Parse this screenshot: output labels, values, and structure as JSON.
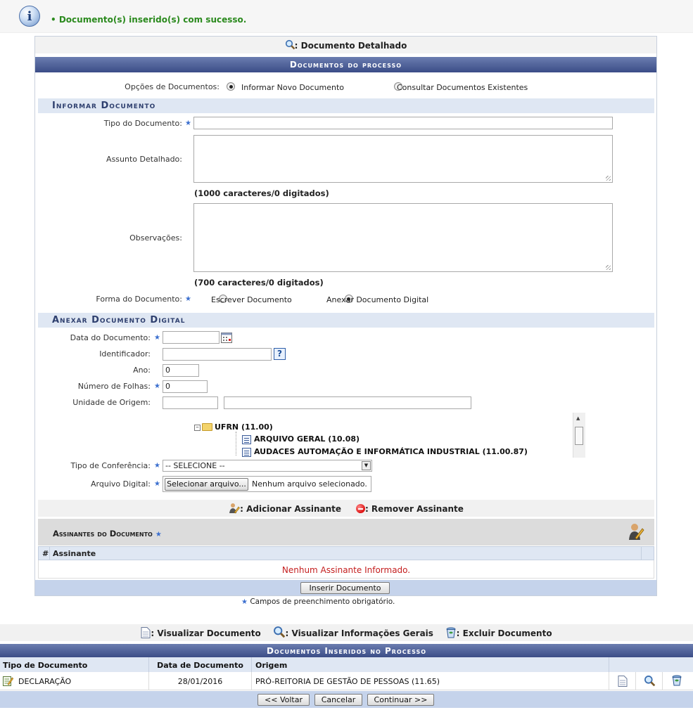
{
  "message": {
    "text": "• Documento(s) inserido(s) com sucesso."
  },
  "form": {
    "top_link": ": Documento Detalhado",
    "section_title": "Documentos do processo",
    "options_label": "Opções de Documentos:",
    "option_new": "Informar Novo Documento",
    "option_existing": "Consultar Documentos Existentes",
    "selected_option": "new",
    "informar_title": "Informar Documento",
    "tipo_label": "Tipo do Documento:",
    "tipo_value": "",
    "assunto_label": "Assunto Detalhado:",
    "assunto_counter": "(1000 caracteres/0 digitados)",
    "observacoes_label": "Observações:",
    "observacoes_counter": "(700 caracteres/0 digitados)",
    "forma_label": "Forma do Documento:",
    "forma_escrever": "Escrever Documento",
    "forma_anexar": "Anexar Documento Digital",
    "forma_selected": "anexar",
    "anexar_title": "Anexar Documento Digital",
    "data_label": "Data do Documento:",
    "data_value": "",
    "identificador_label": "Identificador:",
    "identificador_value": "",
    "ano_label": "Ano:",
    "ano_value": "0",
    "folhas_label": "Número de Folhas:",
    "folhas_value": "0",
    "unidade_label": "Unidade de Origem:",
    "unidade_code": "",
    "unidade_name": "",
    "tree": {
      "root": "UFRN (11.00)",
      "children": [
        "ARQUIVO GERAL (10.08)",
        "AUDACES AUTOMAÇÃO E INFORMÁTICA INDUSTRIAL (11.00.87)"
      ]
    },
    "conferencia_label": "Tipo de Conferência:",
    "conferencia_value": "-- SELECIONE --",
    "arquivo_label": "Arquivo Digital:",
    "arquivo_button": "Selecionar arquivo...",
    "arquivo_status": "Nenhum arquivo selecionado.",
    "add_assinante": ": Adicionar Assinante",
    "remove_assinante": ": Remover Assinante",
    "assinantes_title": "Assinantes do Documento",
    "col_hash": "#",
    "col_assinante": "Assinante",
    "no_assinante": "Nenhum Assinante Informado.",
    "inserir_button": "Inserir Documento",
    "required_note": "Campos de preenchimento obrigatório."
  },
  "legend": {
    "visualizar": ": Visualizar Documento",
    "info": ": Visualizar Informações Gerais",
    "excluir": ": Excluir Documento"
  },
  "inserted": {
    "title": "Documentos Inseridos no Processo",
    "headers": [
      "Tipo de Documento",
      "Data de Documento",
      "Origem"
    ],
    "rows": [
      {
        "tipo": "DECLARAÇÃO",
        "data": "28/01/2016",
        "origem": "PRÓ-REITORIA DE GESTÃO DE PESSOAS (11.65)"
      }
    ]
  },
  "nav": {
    "voltar": "<< Voltar",
    "cancelar": "Cancelar",
    "continuar": "Continuar >>"
  },
  "colors": {
    "success": "#2b8a1e",
    "header": "#3b4d87",
    "error": "#c41e1e",
    "required": "#3b6fcf"
  }
}
